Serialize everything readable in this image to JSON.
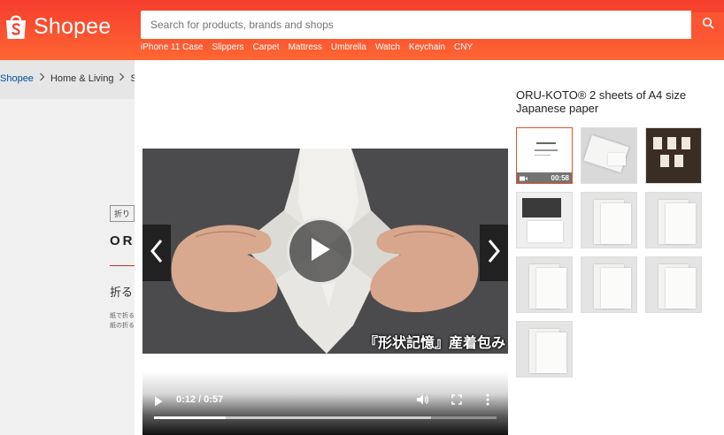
{
  "header": {
    "brand": "Shopee",
    "search_placeholder": "Search for products, brands and shops",
    "hot_links": [
      "iPhone 11 Case",
      "Slippers",
      "Carpet",
      "Mattress",
      "Umbrella",
      "Watch",
      "Keychain",
      "CNY"
    ]
  },
  "breadcrumb": [
    "Shopee",
    "Home & Living",
    "Sta"
  ],
  "background_page": {
    "tag": "折り",
    "title": "ORU",
    "subtitle": "折る",
    "small_text": [
      "紙で折る",
      "紙の折る"
    ]
  },
  "modal": {
    "product_title": "ORU-KOTO® 2 sheets of A4 size Japanese paper",
    "video": {
      "caption": "『形状記憶』産着包み",
      "current_time": "0:12",
      "duration": "0:57",
      "time_display": "0:12 / 0:57",
      "progress_percent": 21
    },
    "thumbnails": [
      {
        "type": "video",
        "duration": "00:58",
        "active": true
      },
      {
        "type": "image"
      },
      {
        "type": "image"
      },
      {
        "type": "image"
      },
      {
        "type": "image"
      },
      {
        "type": "image"
      },
      {
        "type": "image"
      },
      {
        "type": "image"
      },
      {
        "type": "image"
      },
      {
        "type": "image"
      }
    ]
  },
  "colors": {
    "brand": "#ee4d2d",
    "header_gradient_top": "#f53d2d",
    "header_gradient_bottom": "#ff6633"
  },
  "icons": {
    "logo": "shopping-bag-icon",
    "search": "search-icon",
    "prev": "chevron-left-icon",
    "next": "chevron-right-icon",
    "play": "play-icon",
    "volume": "volume-icon",
    "fullscreen": "fullscreen-icon",
    "more": "more-vertical-icon"
  }
}
